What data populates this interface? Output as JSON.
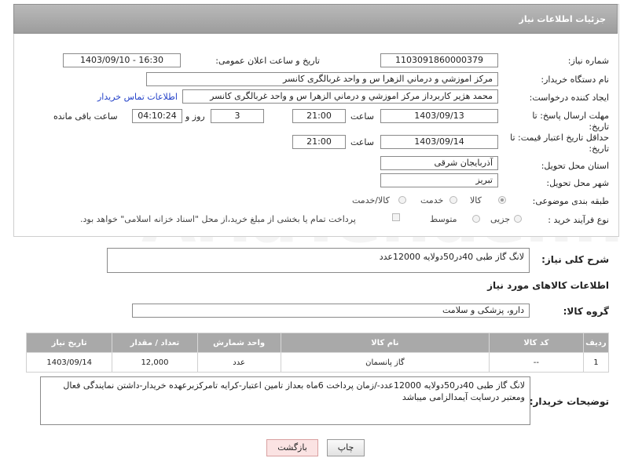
{
  "header": {
    "title": "جزئیات اطلاعات نیاز"
  },
  "fields": {
    "need_number_label": "شماره نیاز:",
    "need_number": "1103091860000379",
    "announce_label": "تاریخ و ساعت اعلان عمومی:",
    "announce_value": "1403/09/10 - 16:30",
    "buyer_label": "نام دستگاه خریدار:",
    "buyer_value": "مرکز اموزشي و درماني الزهرا س  و واحد غربالگری کانسر",
    "creator_label": "ایجاد کننده درخواست:",
    "creator_value": "محمد هژیر کاربرداز مرکز اموزشي و درماني الزهرا س  و واحد غربالگری کانسر",
    "contact_link": "اطلاعات تماس خریدار",
    "deadline_label_1": "مهلت ارسال پاسخ: تا",
    "deadline_label_2": "تاریخ:",
    "deadline_date": "1403/09/13",
    "time_label": "ساعت",
    "deadline_time": "21:00",
    "days_value": "3",
    "days_label": "روز و",
    "remaining_value": "04:10:24",
    "remaining_label": "ساعت باقی مانده",
    "validity_label_1": "حداقل تاریخ اعتبار قیمت: تا",
    "validity_label_2": "تاریخ:",
    "validity_date": "1403/09/14",
    "validity_time": "21:00",
    "province_label": "استان محل تحویل:",
    "province_value": "آذربایجان شرقی",
    "city_label": "شهر محل تحویل:",
    "city_value": "تبریز",
    "category_label": "طبقه بندی موضوعی:",
    "category_options": [
      "کالا",
      "خدمت",
      "کالا/خدمت"
    ],
    "category_selected": "کالا",
    "process_label": "نوع فرآیند خرید :",
    "process_options": [
      "جزیی",
      "متوسط"
    ],
    "payment_note": "پرداخت تمام یا بخشی از مبلغ خرید،از محل \"اسناد خزانه اسلامی\" خواهد بود."
  },
  "summary": {
    "label": "شرح کلی نیاز:",
    "value": "لانگ گاز طبی 40در50دولایه 12000عدد"
  },
  "goods_section": {
    "title": "اطلاعات کالاهای مورد نیاز",
    "group_label": "گروه کالا:",
    "group_value": "دارو، پزشکی و سلامت"
  },
  "table": {
    "headers": [
      "ردیف",
      "کد کالا",
      "نام کالا",
      "واحد شمارش",
      "تعداد / مقدار",
      "تاریخ نیاز"
    ],
    "rows": [
      [
        "1",
        "--",
        "گاز پانسمان",
        "عدد",
        "12,000",
        "1403/09/14"
      ]
    ]
  },
  "buyer_notes": {
    "label": "توضیحات خریدار:",
    "value": "لانگ گاز طبی 40در50دولایه 12000عدد-/زمان پرداخت 6ماه بعداز تامین اعتبار-کرایه تامرکزبرعهده خریدار-داشتن نمایندگی فعال ومعتبر درسایت آیمدالزامی میباشد"
  },
  "buttons": {
    "print": "چاپ",
    "back": "بازگشت"
  },
  "watermark": "AriaTender.neT",
  "colors": {
    "header_bg": "#a9a9a9",
    "link": "#2240c8",
    "back_button_bg": "#fbe3e3"
  }
}
